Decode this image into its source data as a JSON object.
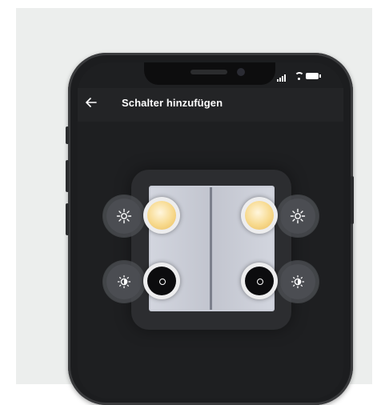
{
  "screen": {
    "title": "Schalter hinzufügen"
  },
  "icons": {
    "back": "arrow-left-icon",
    "brightness_up": "brightness-up-icon",
    "brightness_down": "brightness-down-icon",
    "status": [
      "signal-icon",
      "wifi-icon",
      "battery-icon"
    ]
  },
  "colors": {
    "background": "#eceeed",
    "phone_body": "#1c1d1f",
    "screen": "#1e1f21",
    "switch_plate": "#c9ccd6",
    "warm_light": "#f4d384",
    "off_button": "#0c0c0e"
  }
}
